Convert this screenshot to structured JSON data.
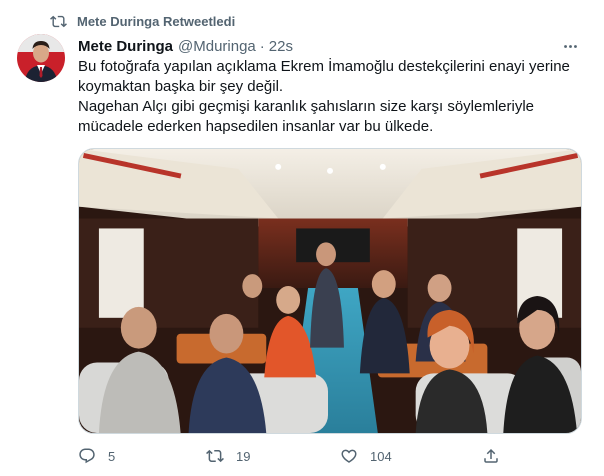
{
  "retweet": {
    "label": "Mete Duringa Retweetledi",
    "icon": "retweet-icon"
  },
  "author": {
    "display_name": "Mete Duringa",
    "handle": "@Mduringa",
    "separator": "·",
    "time": "22s"
  },
  "tweet": {
    "paragraph_1": "Bu fotoğrafa yapılan açıklama Ekrem İmamoğlu destekçilerini enayi yerine koymaktan başka bir şey değil.",
    "paragraph_2": "Nagehan Alçı gibi geçmişi karanlık şahısların size karşı söylemleriyle mücadele ederken hapsedilen insanlar var bu ülkede."
  },
  "media": {
    "description_icon": "photo",
    "accent": "#1d9bf0"
  },
  "actions": {
    "reply_count": "5",
    "retweet_count": "19",
    "like_count": "104"
  },
  "colors": {
    "text": "#0f1419",
    "secondary": "#536471",
    "border": "#cfd9de"
  }
}
